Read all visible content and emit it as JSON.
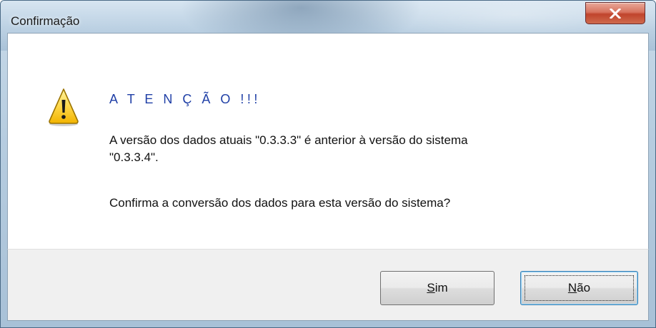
{
  "window": {
    "title": "Confirmação"
  },
  "title_bar": {
    "close_icon": "close-x-icon"
  },
  "dialog": {
    "icon": "warning-triangle-icon",
    "heading": "A T E N Ç Ã O !!!",
    "message_line_1": "A versão dos dados atuais \"0.3.3.3\" é anterior à versão do sistema",
    "message_line_2": "\"0.3.3.4\".",
    "question": "Confirma a conversão dos dados para esta versão do sistema?"
  },
  "buttons": {
    "yes_label": "Sim",
    "no_label": "Não",
    "default_button": "Não"
  },
  "colors": {
    "heading": "#1f3fa6",
    "close_button": "#c0442c",
    "footer_background": "#f0f0f0"
  }
}
